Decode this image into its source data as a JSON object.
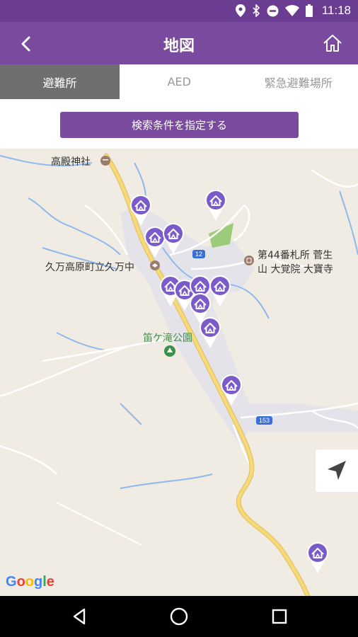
{
  "status": {
    "time": "11:18",
    "icons": [
      "location-icon",
      "bluetooth-icon",
      "do-not-disturb-icon",
      "wifi-icon",
      "battery-icon"
    ]
  },
  "appbar": {
    "title": "地図",
    "back_icon": "chevron-left-icon",
    "home_icon": "home-icon"
  },
  "tabs": [
    {
      "label": "避難所",
      "active": true
    },
    {
      "label": "AED",
      "active": false
    },
    {
      "label": "緊急避難場所",
      "active": false
    }
  ],
  "search": {
    "button_label": "検索条件を指定する"
  },
  "map": {
    "labels": {
      "shrine": "高殿神社",
      "school": "久万高原町立久万中",
      "temple_line1": "第44番札所 菅生",
      "temple_line2": "山 大覚院 大寶寺",
      "park": "笛ケ滝公園"
    },
    "routes": {
      "r12": "12",
      "r153": "153"
    },
    "attribution": "Google",
    "colors": {
      "pin": "#7b5bc9",
      "road_major": "#f7d978",
      "water": "#8fb8ee",
      "park": "#9ccc7a"
    }
  },
  "navbar": {
    "icons": [
      "back-triangle-icon",
      "home-circle-icon",
      "recents-square-icon"
    ]
  }
}
